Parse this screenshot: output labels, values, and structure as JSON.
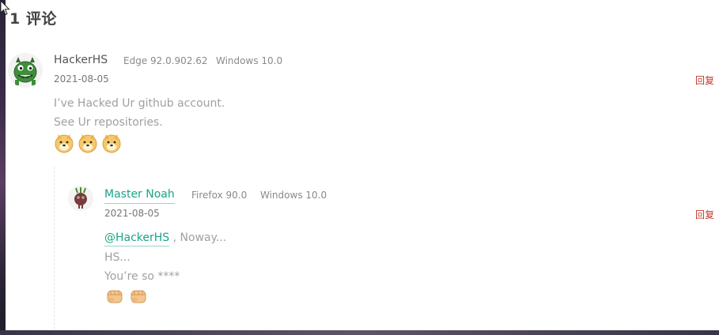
{
  "comments_header": {
    "count_label": "1 评论"
  },
  "comments": [
    {
      "author": "HackerHS",
      "browser": "Edge 92.0.902.62",
      "os": "Windows 10.0",
      "date": "2021-08-05",
      "reply_label": "回复",
      "lines": [
        "I’ve Hacked Ur github account.",
        "See Ur repositories."
      ],
      "emoji_names": [
        "doge-icon",
        "doge-icon",
        "doge-icon"
      ],
      "avatar_icon": "monster-avatar-icon"
    }
  ],
  "replies": [
    {
      "author": "Master Noah",
      "browser": "Firefox 90.0",
      "os": "Windows 10.0",
      "date": "2021-08-05",
      "reply_label": "回复",
      "mention": "@HackerHS",
      "first_line_rest": " , Noway...",
      "lines": [
        "HS...",
        "You’re so ****"
      ],
      "emoji_names": [
        "fist-icon",
        "fist-icon"
      ],
      "avatar_icon": "beet-avatar-icon"
    }
  ],
  "colors": {
    "link": "#1aa389",
    "reply": "#c0392b",
    "muted": "#a0a0a0"
  }
}
